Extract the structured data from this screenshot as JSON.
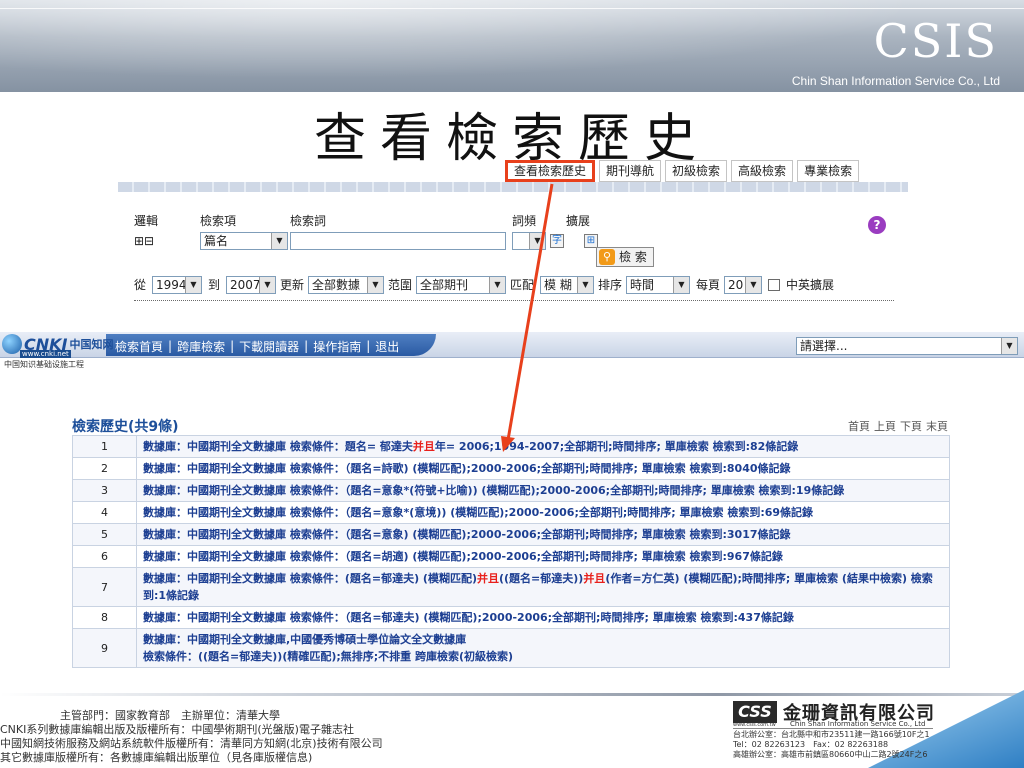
{
  "header": {
    "brand": "CSIS",
    "brand_sub": "Chin Shan Information Service Co., Ltd",
    "title": "查看檢索歷史"
  },
  "tabs": [
    {
      "label": "查看檢索歷史",
      "active": true
    },
    {
      "label": "期刊導航"
    },
    {
      "label": "初級檢索"
    },
    {
      "label": "高級檢索"
    },
    {
      "label": "專業檢索"
    }
  ],
  "search_panel": {
    "col_logic": "邏輯",
    "col_field": "檢索項",
    "col_term": "檢索詞",
    "col_freq": "詞頻",
    "col_extend": "擴展",
    "logic_symbols": "⊞⊟",
    "field_value": "篇名",
    "search_button": "檢 索",
    "from_label": "從",
    "from_year": "1994",
    "to_label": "到",
    "to_year": "2007",
    "update_label": "更新",
    "update_value": "全部數據",
    "range_label": "范圍",
    "range_value": "全部期刊",
    "match_label": "匹配",
    "match_value": "模 糊",
    "sort_label": "排序",
    "sort_value": "時間",
    "per_page_label": "每頁",
    "per_page_value": "20",
    "cn_en_label": "中英擴展"
  },
  "cnki": {
    "logo_word": "CNKI",
    "logo_cn": "中国知网",
    "logo_url": "www.cnki.net",
    "subtitle": "中国知识基础设施工程",
    "nav": [
      "檢索首頁",
      "跨庫檢索",
      "下載閱讀器",
      "操作指南",
      "退出"
    ],
    "select_value": "請選擇..."
  },
  "history": {
    "title": "檢索歷史(共9條)",
    "pager": [
      "首頁",
      "上頁",
      "下頁",
      "末頁"
    ],
    "rows": [
      {
        "n": "1",
        "text": "數據庫：中國期刊全文數據庫 檢索條件：題名= 郁達夫",
        "red": "并且",
        "text2": "年= 2006;1994-2007;全部期刊;時間排序; 單庫檢索 檢索到:82條記錄"
      },
      {
        "n": "2",
        "text": "數據庫：中國期刊全文數據庫 檢索條件：（題名=詩歌) (模糊匹配);2000-2006;全部期刊;時間排序; 單庫檢索 檢索到:8040條記錄"
      },
      {
        "n": "3",
        "text": "數據庫：中國期刊全文數據庫 檢索條件：（題名=意象*(符號+比喻)) (模糊匹配);2000-2006;全部期刊;時間排序; 單庫檢索 檢索到:19條記錄"
      },
      {
        "n": "4",
        "text": "數據庫：中國期刊全文數據庫 檢索條件：（題名=意象*(意境)) (模糊匹配);2000-2006;全部期刊;時間排序; 單庫檢索 檢索到:69條記錄"
      },
      {
        "n": "5",
        "text": "數據庫：中國期刊全文數據庫 檢索條件：（題名=意象) (模糊匹配);2000-2006;全部期刊;時間排序; 單庫檢索 檢索到:3017條記錄"
      },
      {
        "n": "6",
        "text": "數據庫：中國期刊全文數據庫 檢索條件：（題名=胡適) (模糊匹配);2000-2006;全部期刊;時間排序; 單庫檢索 檢索到:967條記錄"
      },
      {
        "n": "7",
        "text": "數據庫：中國期刊全文數據庫 檢索條件：(題名=郁達夫) (模糊匹配)",
        "red": "并且",
        "text2": "((題名=郁達夫))",
        "red2": "并且",
        "text3": "(作者=方仁英) (模糊匹配);時間排序; 單庫檢索 (結果中檢索) 檢索到:1條記錄"
      },
      {
        "n": "8",
        "text": "數據庫：中國期刊全文數據庫 檢索條件：（題名=郁達夫) (模糊匹配);2000-2006;全部期刊;時間排序; 單庫檢索 檢索到:437條記錄"
      },
      {
        "n": "9",
        "text": "數據庫：中國期刊全文數據庫,中國優秀博碩士學位論文全文數據庫",
        "text_line2": "檢索條件：((題名=郁達夫))(精確匹配);無排序;不排重 跨庫檢索(初級檢索)"
      }
    ]
  },
  "footer": {
    "line1": "主管部門：國家教育部　主辦單位：清華大學",
    "line2": "CNKI系列數據庫編輯出版及版權所有：中國學術期刊(光盤版)電子雜志社",
    "line3": "中國知網技術服務及網站系統軟件版權所有：清華同方知網(北京)技術有限公司",
    "line4": "其它數據庫版權所有：各數據庫編輯出版單位（見各庫版權信息)",
    "company_mark": "CSS",
    "company_name": "金珊資訊有限公司",
    "company_en": "Chin Shan Information Service Co., Ltd",
    "company_web": "www.csis.com.tw",
    "addr1": "台北辦公室：台北縣中和市23511建一路166號10F之1",
    "addr2": "Tel：02 82263123　Fax：02 82263188",
    "addr3": "高雄辦公室：高雄市前鎮區80660中山二路2號24F之6"
  },
  "colors": {
    "accent_red": "#e8401c",
    "link_blue": "#1d3f92",
    "help_purple": "#9a3cc0"
  }
}
